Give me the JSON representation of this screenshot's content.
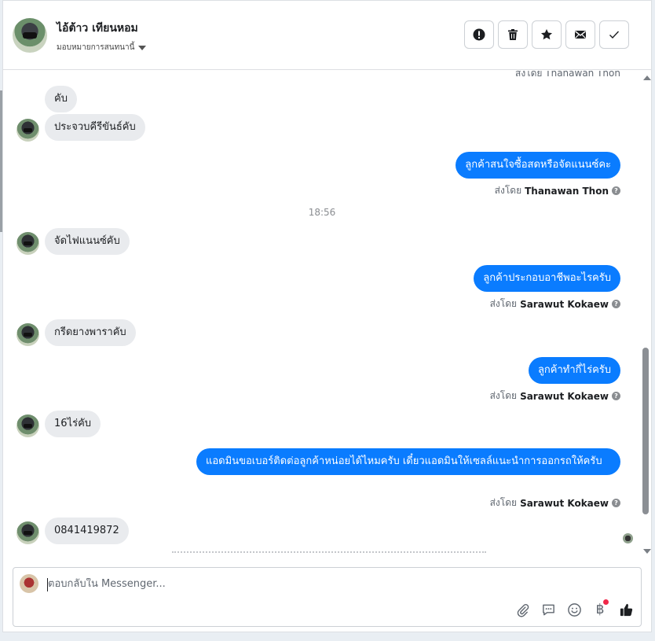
{
  "header": {
    "name": "ไอ้ต้าว เทียนหอม",
    "assign_label": "มอบหมายการสนทนานี้",
    "actions": [
      "mark-spam",
      "delete",
      "star",
      "mark-unread",
      "mark-done"
    ]
  },
  "thread": {
    "cut_top_text": "ส่งโดย Thanawan Thon",
    "messages": [
      {
        "dir": "in",
        "text": "คับ"
      },
      {
        "dir": "in",
        "text": "ประจวบคีรีขันธ์คับ"
      },
      {
        "dir": "out",
        "text": "ลูกค้าสนใจซื้อสดหรือจัดแนนซ์คะ",
        "sent_by_prefix": "ส่งโดย",
        "sent_by": "Thanawan Thon"
      },
      {
        "dir": "time",
        "text": "18:56"
      },
      {
        "dir": "in",
        "text": "จัดไฟแนนซ์คับ"
      },
      {
        "dir": "out",
        "text": "ลูกค้าประกอบอาชีพอะไรครับ",
        "sent_by_prefix": "ส่งโดย",
        "sent_by": "Sarawut Kokaew"
      },
      {
        "dir": "in",
        "text": "กรีดยางพาราคับ"
      },
      {
        "dir": "out",
        "text": "ลูกค้าทำกี่ไร่ครับ",
        "sent_by_prefix": "ส่งโดย",
        "sent_by": "Sarawut Kokaew"
      },
      {
        "dir": "in",
        "text": "16ไร่คับ"
      },
      {
        "dir": "out",
        "text": "แอดมินขอเบอร์ติดต่อลูกค้าหน่อยได้ไหมครับ เดี๋ยวแอดมินให้เซลล์แนะนำการออกรถให้ครับ",
        "sent_by_prefix": "ส่งโดย",
        "sent_by": "Sarawut Kokaew"
      },
      {
        "dir": "in",
        "text": "0841419872"
      }
    ]
  },
  "composer": {
    "placeholder": "ตอบกลับใน Messenger...",
    "tools": [
      "attachment-icon",
      "saved-reply-icon",
      "emoji-icon",
      "payment-icon",
      "like-icon"
    ],
    "payment_glyph": "฿"
  },
  "colors": {
    "outgoing": "#0a7cff",
    "incoming": "#e9ebee",
    "notification": "#f02849"
  }
}
